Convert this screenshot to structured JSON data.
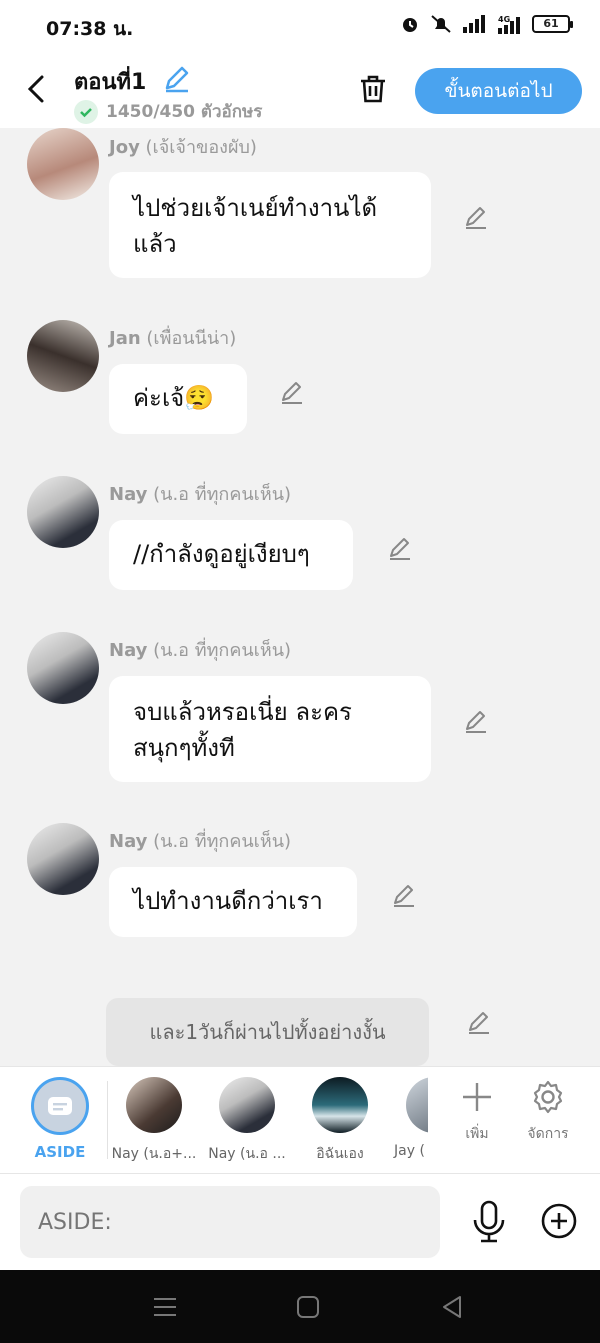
{
  "status": {
    "time": "07:38 น.",
    "battery": "61"
  },
  "header": {
    "episode_title": "ตอนที่1",
    "char_count": "1450/450 ตัวอักษร",
    "next_label": "ขั้นตอนต่อไป"
  },
  "messages": [
    {
      "name": "Joy",
      "role": "(เจ้เจ้าของผับ)",
      "text_lines": [
        "ไปช่วยเจ้าเนย์ทำงานได้",
        "แล้ว"
      ]
    },
    {
      "name": "Jan",
      "role": "(เพื่อนนีน่า)",
      "text_lines": [
        "ค่ะเจ้😮‍💨"
      ]
    },
    {
      "name": "Nay",
      "role": "(น.อ ที่ทุกคนเห็น)",
      "text_lines": [
        "//กำลังดูอยู่เงียบๆ"
      ]
    },
    {
      "name": "Nay",
      "role": "(น.อ ที่ทุกคนเห็น)",
      "text_lines": [
        "จบแล้วหรอเนี่ย ละคร",
        "สนุกๆทั้งที"
      ]
    },
    {
      "name": "Nay",
      "role": "(น.อ ที่ทุกคนเห็น)",
      "text_lines": [
        "ไปทำงานดีกว่าเรา"
      ]
    }
  ],
  "aside_message": "และ1วันก็ผ่านไปทั้งอย่างงั้น",
  "characters": {
    "aside_label": "ASIDE",
    "items": [
      "Nay (น.อ+...",
      "Nay (น.อ ...",
      "อิฉันเอง",
      "Jay ("
    ],
    "add_label": "เพิ่ม",
    "manage_label": "จัดการ"
  },
  "input": {
    "placeholder": "ASIDE:"
  },
  "colors": {
    "accent": "#4aa3ef",
    "background": "#f2f2f2",
    "check_green": "#2fb65f"
  }
}
